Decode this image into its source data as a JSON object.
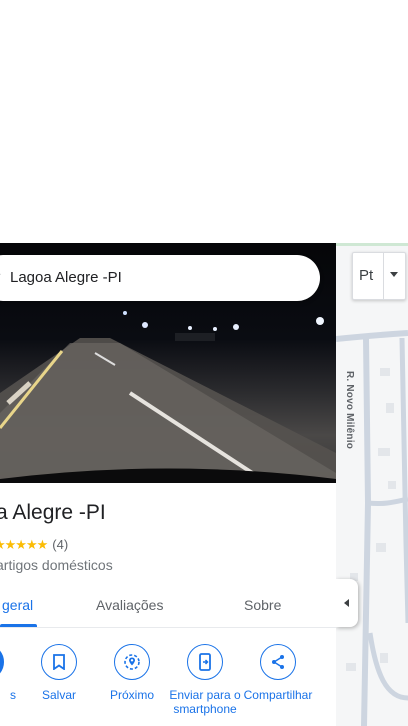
{
  "search": {
    "value": "Lagoa Alegre -PI"
  },
  "place": {
    "title": "a Alegre -PI",
    "stars": "★★★★★",
    "review_count": "(4)",
    "category": "artigos domésticos"
  },
  "tabs": [
    {
      "label": "geral"
    },
    {
      "label": "Avaliações"
    },
    {
      "label": "Sobre"
    }
  ],
  "actions": [
    {
      "label": "s",
      "icon": "directions-icon"
    },
    {
      "label": "Salvar",
      "icon": "bookmark-icon"
    },
    {
      "label": "Próximo",
      "icon": "nearby-icon"
    },
    {
      "label": "Enviar para o smartphone",
      "icon": "send-to-phone-icon"
    },
    {
      "label": "Compartilhar",
      "icon": "share-icon"
    }
  ],
  "map": {
    "street_label": "R. Novo Milênio",
    "layer_button": "Pt"
  },
  "colors": {
    "accent": "#1a73e8",
    "star": "#fbbc04"
  }
}
